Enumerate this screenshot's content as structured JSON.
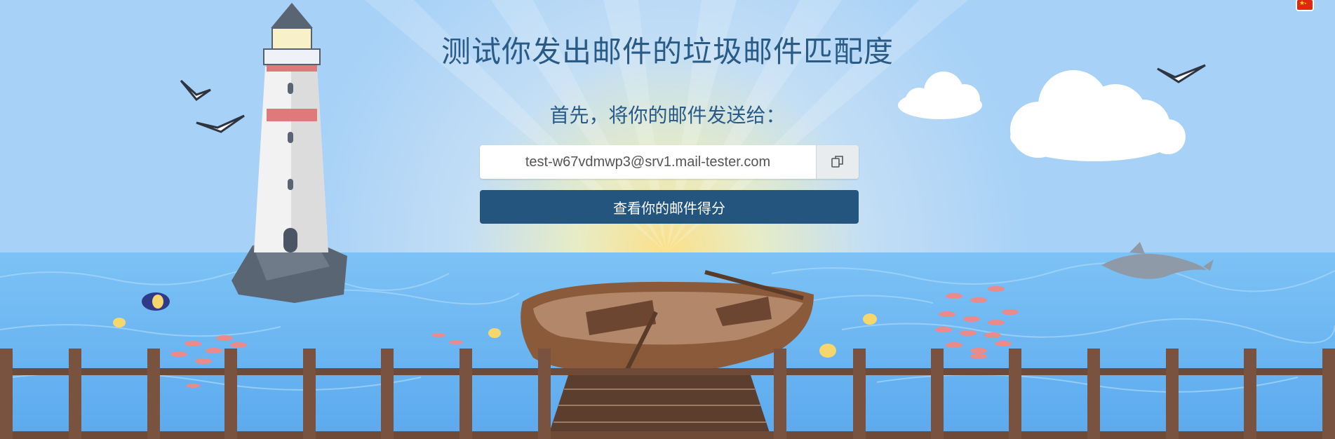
{
  "page": {
    "title": "测试你发出邮件的垃圾邮件匹配度",
    "subtitle": "首先，将你的邮件发送给：",
    "email": "test-w67vdmwp3@srv1.mail-tester.com",
    "check_button_label": "查看你的邮件得分",
    "copy_icon": "copy-icon",
    "language_flag": "china-flag-icon"
  },
  "colors": {
    "sky": "#a9d3f7",
    "sea": "#66b3f2",
    "title_text": "#2a5a86",
    "button": "#23557f",
    "fence": "#7a5240",
    "boat": "#8a5a3b"
  }
}
